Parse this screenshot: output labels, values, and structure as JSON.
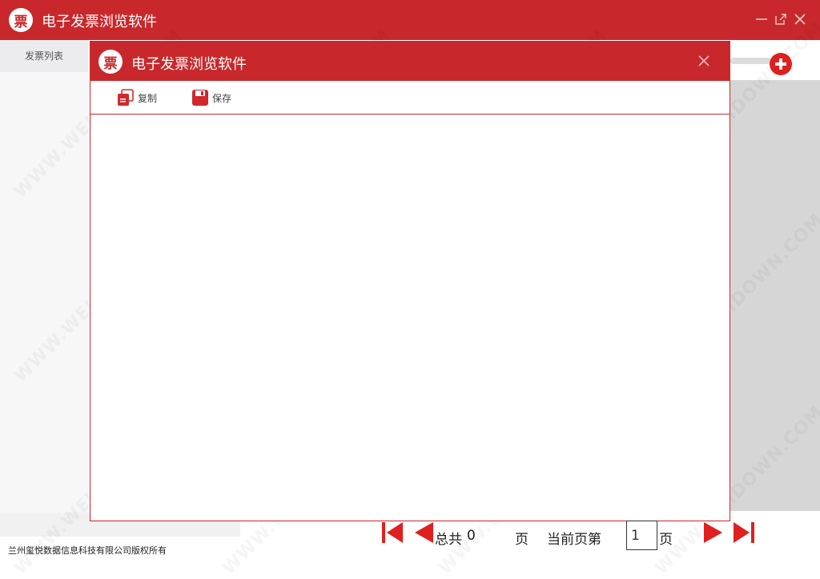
{
  "app": {
    "title": "电子发票浏览软件",
    "logo_char": "票"
  },
  "window_controls": {
    "minimize": "minimize-icon",
    "maximize": "maximize-icon",
    "close": "close-icon"
  },
  "sidebar": {
    "tab_label": "发票列表"
  },
  "dialog": {
    "title": "电子发票浏览软件",
    "logo_char": "票",
    "toolbar": {
      "copy_label": "复制",
      "save_label": "保存"
    }
  },
  "footer": {
    "copyright": "兰州玺悦数据信息科技有限公司版权所有"
  },
  "pager": {
    "total_label": "总共",
    "total_count": "0",
    "page_unit": "页",
    "current_label": "当前页第",
    "current_page": "1",
    "current_unit": "页"
  },
  "watermark": {
    "text": "WWW.WEIDOWN.COM"
  },
  "colors": {
    "brand_red": "#c8282b",
    "pager_red": "#e0201e"
  }
}
